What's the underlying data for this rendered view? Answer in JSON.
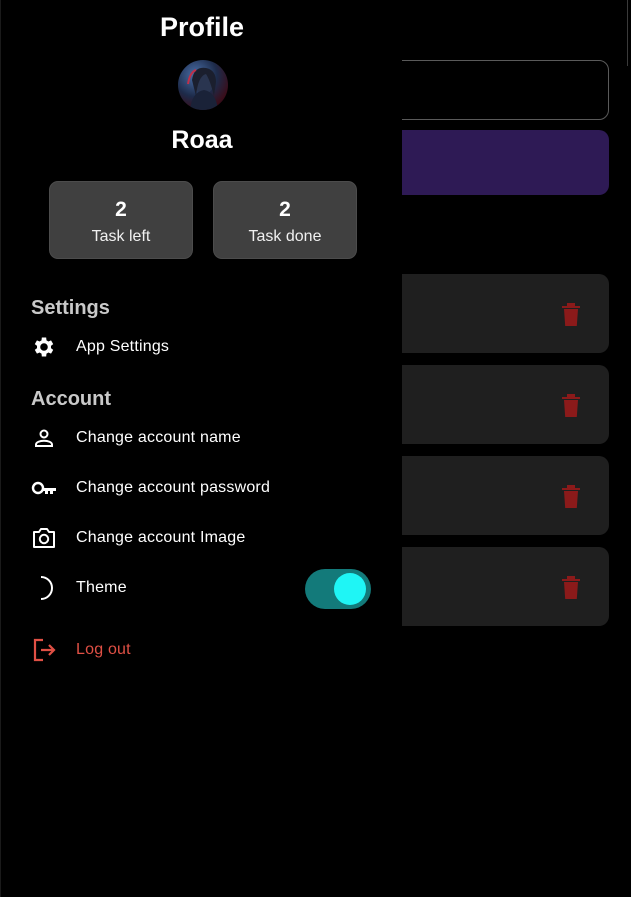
{
  "drawer": {
    "title": "Profile",
    "user_name": "Roaa",
    "stats": [
      {
        "value": "2",
        "label": "Task left"
      },
      {
        "value": "2",
        "label": "Task done"
      }
    ],
    "sections": {
      "settings": "Settings",
      "account": "Account"
    },
    "menu": {
      "app_settings": "App Settings",
      "change_name": "Change account name",
      "change_password": "Change account password",
      "change_image": "Change account Image",
      "theme": "Theme",
      "logout": "Log out"
    },
    "theme_toggle_on": true
  },
  "colors": {
    "accent": "#1ff5f5",
    "toggle_track": "#137a7a",
    "logout": "#e05045",
    "delete": "#8b1a1a",
    "primary_button": "#2e1a55"
  },
  "icons": [
    "gear-icon",
    "person-icon",
    "key-icon",
    "camera-icon",
    "moon-icon",
    "logout-icon",
    "trash-icon"
  ]
}
